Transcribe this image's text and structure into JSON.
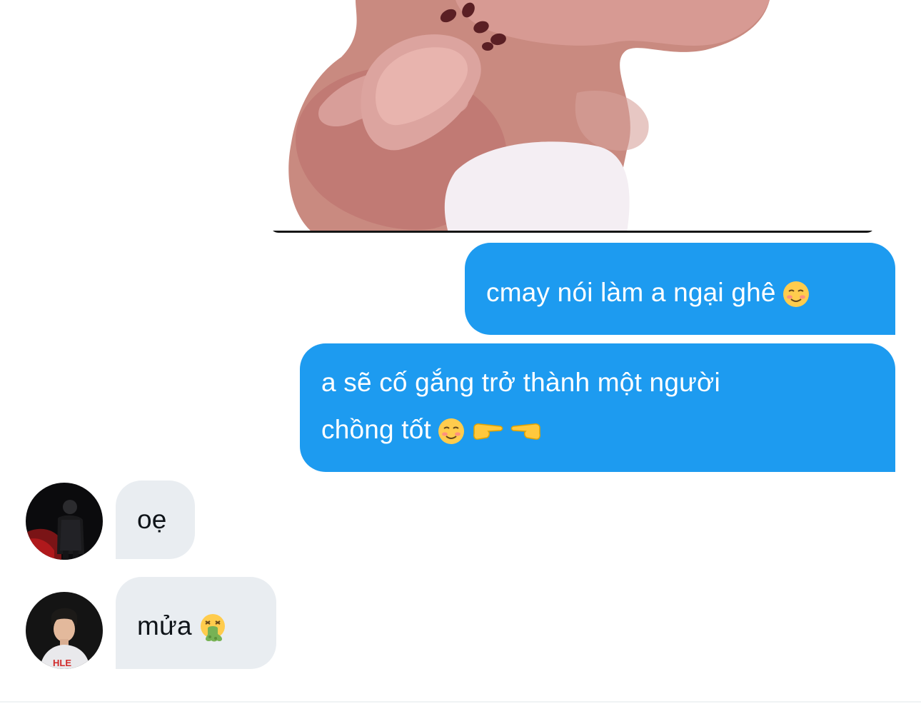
{
  "conversation": {
    "messages": [
      {
        "id": "msg1",
        "direction": "sent",
        "text": "cmay nói làm a ngại ghê",
        "emojis": [
          "smiling-face-icon"
        ]
      },
      {
        "id": "msg2",
        "direction": "sent",
        "line1": "a sẽ cố gắng trở thành một người",
        "line2": "chồng tốt",
        "emojis": [
          "smiling-face-icon",
          "pointing-right-icon",
          "pointing-left-icon"
        ]
      },
      {
        "id": "msg3",
        "direction": "received",
        "text": "oẹ"
      },
      {
        "id": "msg4",
        "direction": "received",
        "text": "mửa",
        "emojis": [
          "vomiting-face-icon"
        ]
      }
    ]
  },
  "colors": {
    "sent_bubble": "#1d9bf0",
    "received_bubble": "#e9edf1",
    "sent_text": "#ffffff",
    "received_text": "#0f1419"
  }
}
